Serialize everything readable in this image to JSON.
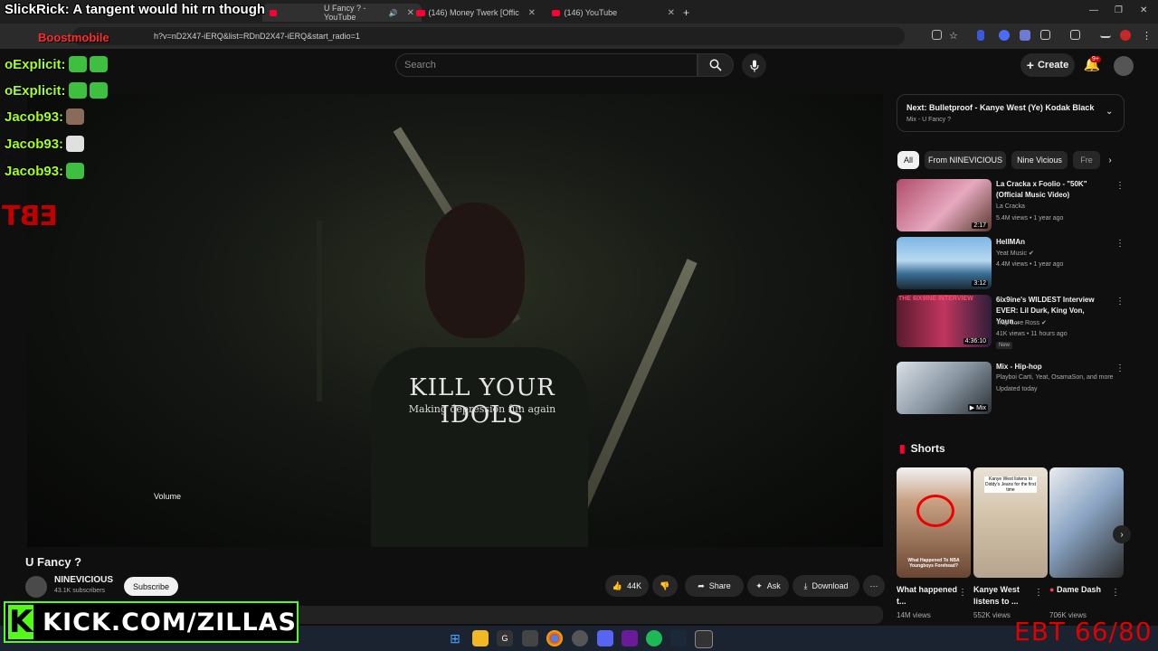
{
  "browser": {
    "tabs": [
      {
        "label": "U Fancy ? - YouTube",
        "active": true
      },
      {
        "label": "(146) Money Twerk [Official M..."
      },
      {
        "label": "(146) YouTube"
      }
    ],
    "new_tab": "+",
    "url": "h?v=nD2X47-iERQ&list=RDnD2X47-iERQ&start_radio=1"
  },
  "youtube": {
    "search_placeholder": "Search",
    "create_label": "Create",
    "notif_count": "9+"
  },
  "video": {
    "shirt_text": "KILL YOUR IDOLS",
    "shirt_subtext": "Making depression fun again",
    "volume_tooltip": "Volume",
    "title": "U Fancy ?",
    "channel": "NINEVICIOUS",
    "subscribers": "43.1K subscribers",
    "subscribe_label": "Subscribe",
    "likes": "44K",
    "share_label": "Share",
    "ask_label": "Ask",
    "download_label": "Download",
    "more": "···"
  },
  "up_next": {
    "title": "Next: Bulletproof - Kanye West (Ye) Kodak Black",
    "subtitle": "Mix - U Fancy ?"
  },
  "chips": [
    "All",
    "From NINEVICIOUS",
    "Nine Vicious",
    "Fre"
  ],
  "recommendations": [
    {
      "title": "La Cracka x Foolio - \"50K\" (Official Music Video)",
      "channel": "La Cracka",
      "meta": "5.4M views • 1 year ago",
      "duration": "2:17"
    },
    {
      "title": "HellMAn",
      "channel": "Yeat Music",
      "meta": "4.4M views • 1 year ago",
      "duration": "3:12"
    },
    {
      "title": "6ix9ine's WILDEST Interview EVER: Lil Durk, King Von, Youn...",
      "channel": "Trap Lore Ross",
      "meta": "41K views • 11 hours ago",
      "badge": "New",
      "duration": "4:36:10",
      "thumb_text": "THE 6IX9INE INTERVIEW"
    },
    {
      "title": "Mix - Hip-hop",
      "channel": "Playboi Carti, Yeat, OsamaSon, and more",
      "meta": "Updated today",
      "duration": "Mix"
    }
  ],
  "shorts": {
    "header": "Shorts",
    "items": [
      {
        "title": "What happened t...",
        "views": "14M views",
        "thumb_caption": "What Happened To NBA Youngboys Forehead?"
      },
      {
        "title": "Kanye West listens to ...",
        "views": "552K views",
        "thumb_caption": "Kanye West listens to Diddy's Jeans for the first time"
      },
      {
        "title": "Dame Dash",
        "views": "706K views"
      }
    ]
  },
  "overlay": {
    "top_chat": "SlickRick: A tangent would hit rn though",
    "top_chat_user": "Boostmobile",
    "chat": [
      {
        "user": "oExplicit:",
        "emotes": 2
      },
      {
        "user": "oExplicit:",
        "emotes": 2
      },
      {
        "user": "Jacob93:",
        "emotes": 1
      },
      {
        "user": "Jacob93:",
        "emotes": 1
      },
      {
        "user": "Jacob93:",
        "emotes": 1
      }
    ],
    "ebt_logo": "EBT",
    "kick_url": "KICK.COM/ZILLAS",
    "ebt_counter": "EBT 66/80"
  },
  "colors": {
    "youtube_red": "#ff0033",
    "kick_green": "#53fc18",
    "chat_green": "#a6ff1a",
    "ebt_red": "#e00000"
  }
}
